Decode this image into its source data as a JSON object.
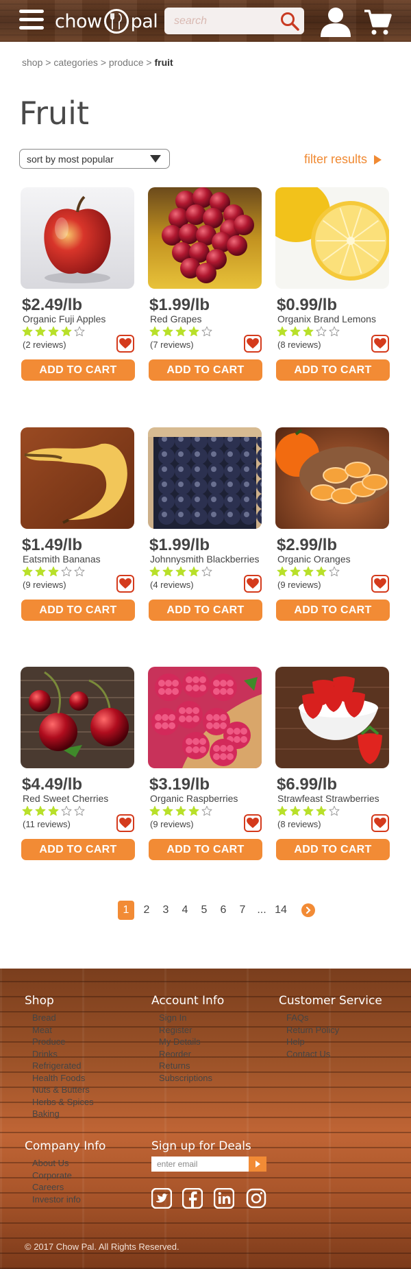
{
  "header": {
    "logo_left": "chow",
    "logo_right": "pal",
    "search_placeholder": "search"
  },
  "breadcrumb": {
    "items": [
      "shop",
      "categories",
      "produce"
    ],
    "separator": ">",
    "current": "fruit"
  },
  "page_title": "Fruit",
  "sort": {
    "selected": "sort by most popular"
  },
  "filter_label": "filter results",
  "products": [
    {
      "price": "$2.49/lb",
      "name": "Organic Fuji Apples",
      "rating": 4,
      "reviews": "(2 reviews)",
      "cta": "ADD TO CART",
      "image": "apple"
    },
    {
      "price": "$1.99/lb",
      "name": "Red Grapes",
      "rating": 4,
      "reviews": "(7 reviews)",
      "cta": "ADD TO CART",
      "image": "grapes"
    },
    {
      "price": "$0.99/lb",
      "name": "Organix Brand Lemons",
      "rating": 3,
      "reviews": "(8 reviews)",
      "cta": "ADD TO CART",
      "image": "lemon"
    },
    {
      "price": "$1.49/lb",
      "name": "Eatsmith Bananas",
      "rating": 3,
      "reviews": "(9 reviews)",
      "cta": "ADD TO CART",
      "image": "banana"
    },
    {
      "price": "$1.99/lb",
      "name": "Johnnysmith Blackberries",
      "rating": 4,
      "reviews": "(4 reviews)",
      "cta": "ADD TO CART",
      "image": "blackberries"
    },
    {
      "price": "$2.99/lb",
      "name": "Organic Oranges",
      "rating": 4,
      "reviews": "(9 reviews)",
      "cta": "ADD TO CART",
      "image": "oranges"
    },
    {
      "price": "$4.49/lb",
      "name": "Red Sweet Cherries",
      "rating": 3,
      "reviews": "(11 reviews)",
      "cta": "ADD TO CART",
      "image": "cherries"
    },
    {
      "price": "$3.19/lb",
      "name": "Organic Raspberries",
      "rating": 4,
      "reviews": "(9 reviews)",
      "cta": "ADD TO CART",
      "image": "raspberries"
    },
    {
      "price": "$6.99/lb",
      "name": "Strawfeast Strawberries",
      "rating": 4,
      "reviews": "(8 reviews)",
      "cta": "ADD TO CART",
      "image": "strawberries"
    }
  ],
  "pagination": {
    "pages": [
      "1",
      "2",
      "3",
      "4",
      "5",
      "6",
      "7",
      "...",
      "14"
    ],
    "current": "1"
  },
  "footer": {
    "shop": {
      "heading": "Shop",
      "links": [
        "Bread",
        "Meat",
        "Produce",
        "Drinks",
        "Refrigerated",
        "Health Foods",
        "Nuts & Butters",
        "Herbs & Spices",
        "Baking"
      ]
    },
    "account": {
      "heading": "Account Info",
      "links": [
        "Sign In",
        "Register",
        "My Details",
        "Reorder",
        "Returns",
        "Subscriptions"
      ]
    },
    "service": {
      "heading": "Customer Service",
      "links": [
        "FAQs",
        "Return Policy",
        "Help",
        "Contact Us"
      ]
    },
    "company": {
      "heading": "Company Info",
      "links": [
        "About Us",
        "Corporate",
        "Careers",
        "Investor info"
      ]
    },
    "deals": {
      "heading": "Sign up for Deals",
      "email_placeholder": "enter email"
    },
    "social": [
      "twitter-icon",
      "facebook-icon",
      "linkedin-icon",
      "instagram-icon"
    ],
    "copyright": "© 2017 Chow Pal.  All Rights Reserved."
  },
  "colors": {
    "accent": "#f28b35",
    "star": "#b8e02a",
    "heart": "#d43a1c"
  }
}
